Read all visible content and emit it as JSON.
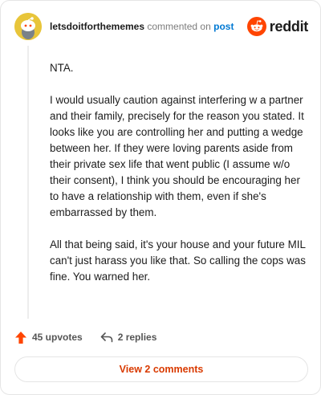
{
  "comment": {
    "username": "letsdoitforthememes",
    "action_text": "commented on",
    "post_link_text": "post",
    "paragraphs": [
      "NTA.",
      "I would usually caution against interfering w a partner and their family, precisely for the reason you stated. It looks like you are controlling her and putting a wedge between her. If they were loving parents aside from their private sex life that went public (I assume w/o their consent), I think you should be encouraging her to have a relationship with them, even if she's embarrassed by them.",
      "All that being said, it's your house and your future MIL can't just harass you like that. So calling the cops was fine. You warned her."
    ]
  },
  "brand": {
    "wordmark": "reddit",
    "icon": "reddit-logo-icon",
    "color": "#ff4500"
  },
  "actions": {
    "upvotes_label": "45 upvotes",
    "upvote_icon": "upvote-arrow-icon",
    "upvote_color": "#ff4500",
    "replies_label": "2 replies",
    "reply_icon": "reply-arrow-icon"
  },
  "view_button": {
    "label": "View 2 comments",
    "color": "#d93a00"
  }
}
